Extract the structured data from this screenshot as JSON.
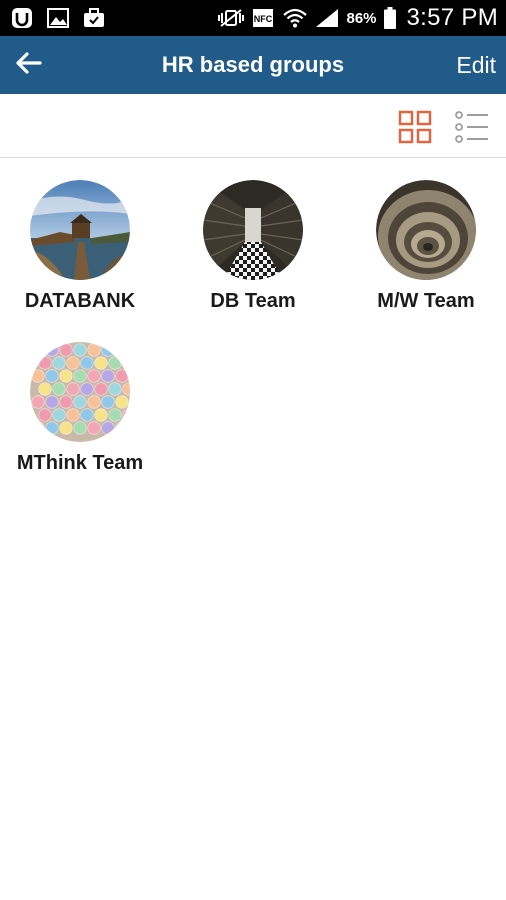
{
  "status_bar": {
    "icons_left": [
      "uc-browser-icon",
      "gallery-icon",
      "briefcase-icon"
    ],
    "icons_right": [
      "vibrate-icon",
      "nfc-icon",
      "wifi-icon",
      "signal-icon",
      "battery-icon"
    ],
    "battery": "86%",
    "time": "3:57 PM"
  },
  "app_bar": {
    "back_icon": "arrow-left-icon",
    "title": "HR based groups",
    "edit_label": "Edit",
    "background": "#215b89"
  },
  "view_toggle": {
    "grid_icon": "grid-view-icon",
    "list_icon": "list-view-icon",
    "active": "grid",
    "active_color": "#e8603c",
    "inactive_color": "#9e9e9e"
  },
  "groups": [
    {
      "name": "DATABANK",
      "image": "lakeside-pier-photo"
    },
    {
      "name": "DB Team",
      "image": "library-aisle-photo"
    },
    {
      "name": "M/W Team",
      "image": "spiral-staircase-photo"
    },
    {
      "name": "MThink Team",
      "image": "colored-chalk-photo"
    }
  ]
}
